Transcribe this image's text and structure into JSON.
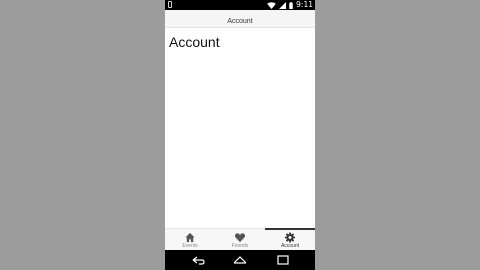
{
  "status_bar": {
    "time": "9:11",
    "icons": [
      "notification-icon",
      "wifi-icon",
      "signal-icon",
      "battery-icon"
    ]
  },
  "app_bar": {
    "title": "Account"
  },
  "main": {
    "heading": "Account"
  },
  "tabs": [
    {
      "label": "Events",
      "icon": "home-icon",
      "active": false
    },
    {
      "label": "Friends",
      "icon": "heart-icon",
      "active": false
    },
    {
      "label": "Account",
      "icon": "gear-icon",
      "active": true
    }
  ],
  "nav_bar": {
    "buttons": [
      "back-icon",
      "home-nav-icon",
      "recents-icon"
    ]
  },
  "colors": {
    "background": "#9c9c9c",
    "tab_icon": "#555555",
    "active_indicator": "#333333"
  }
}
